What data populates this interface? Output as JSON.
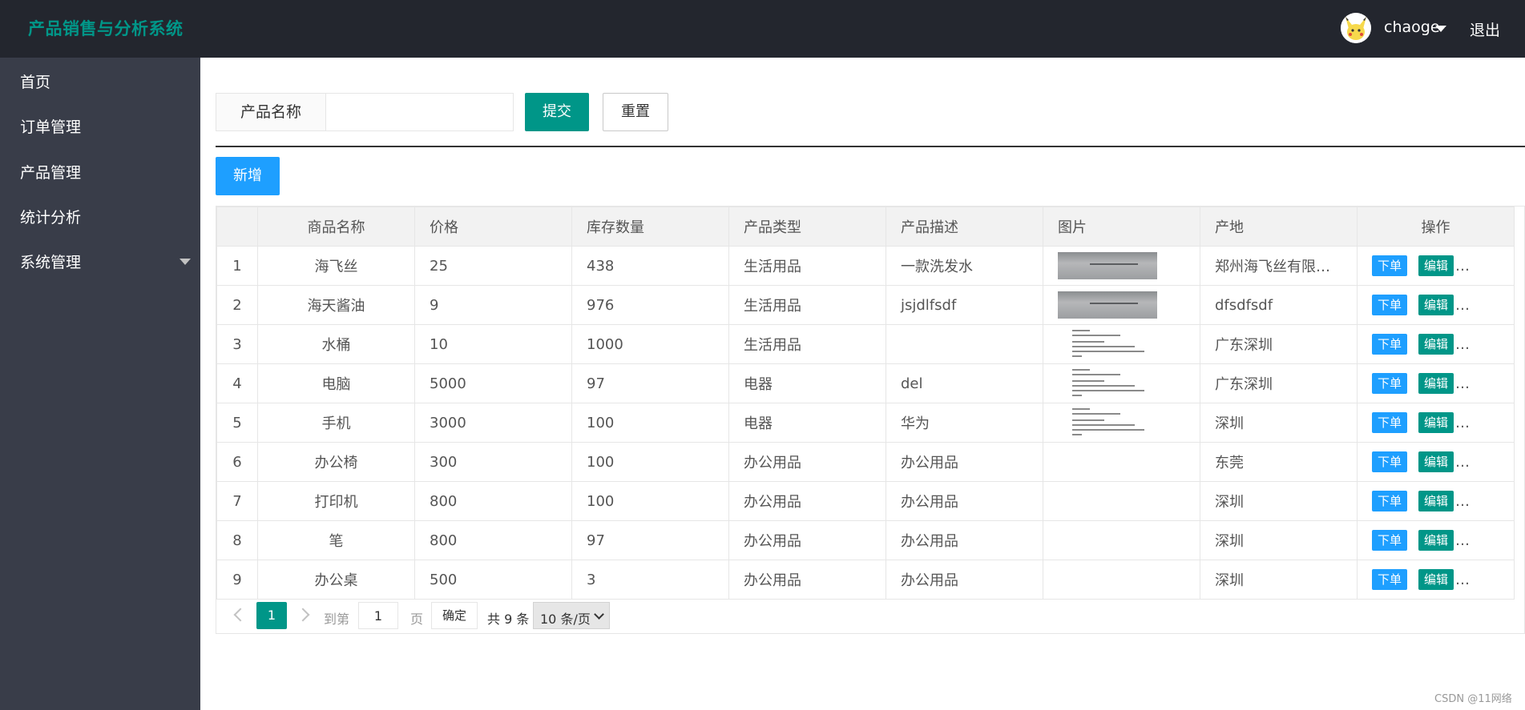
{
  "app": {
    "title": "产品销售与分析系统",
    "username": "chaoge",
    "logout_label": "退出"
  },
  "sidebar": {
    "items": [
      {
        "label": "首页"
      },
      {
        "label": "订单管理"
      },
      {
        "label": "产品管理"
      },
      {
        "label": "统计分析"
      },
      {
        "label": "系统管理",
        "has_submenu": true
      }
    ]
  },
  "search": {
    "label": "产品名称",
    "value": "",
    "submit_label": "提交",
    "reset_label": "重置"
  },
  "toolbar": {
    "add_label": "新增"
  },
  "table": {
    "columns": [
      "",
      "商品名称",
      "价格",
      "库存数量",
      "产品类型",
      "产品描述",
      "图片",
      "产地",
      "操作"
    ],
    "order_label": "下单",
    "edit_label": "编辑",
    "more_label": "…",
    "rows": [
      {
        "no": "1",
        "name": "海飞丝",
        "price": "25",
        "stock": "438",
        "type": "生活用品",
        "desc": "一款洗发水",
        "image": "photo",
        "origin": "郑州海飞丝有限责任公司"
      },
      {
        "no": "2",
        "name": "海天酱油",
        "price": "9",
        "stock": "976",
        "type": "生活用品",
        "desc": "jsjdlfsdf",
        "image": "photo",
        "origin": "dfsdfsdf"
      },
      {
        "no": "3",
        "name": "水桶",
        "price": "10",
        "stock": "1000",
        "type": "生活用品",
        "desc": "",
        "image": "document",
        "origin": "广东深圳"
      },
      {
        "no": "4",
        "name": "电脑",
        "price": "5000",
        "stock": "97",
        "type": "电器",
        "desc": "del",
        "image": "document",
        "origin": "广东深圳"
      },
      {
        "no": "5",
        "name": "手机",
        "price": "3000",
        "stock": "100",
        "type": "电器",
        "desc": "华为",
        "image": "document",
        "origin": "深圳"
      },
      {
        "no": "6",
        "name": "办公椅",
        "price": "300",
        "stock": "100",
        "type": "办公用品",
        "desc": "办公用品",
        "image": "",
        "origin": "东莞"
      },
      {
        "no": "7",
        "name": "打印机",
        "price": "800",
        "stock": "100",
        "type": "办公用品",
        "desc": "办公用品",
        "image": "",
        "origin": "深圳"
      },
      {
        "no": "8",
        "name": "笔",
        "price": "800",
        "stock": "97",
        "type": "办公用品",
        "desc": "办公用品",
        "image": "",
        "origin": "深圳"
      },
      {
        "no": "9",
        "name": "办公桌",
        "price": "500",
        "stock": "3",
        "type": "办公用品",
        "desc": "办公用品",
        "image": "",
        "origin": "深圳"
      }
    ]
  },
  "pager": {
    "current_page": "1",
    "goto_label": "到第",
    "goto_value": "1",
    "page_unit": "页",
    "confirm_label": "确定",
    "total_text": "共 9 条",
    "page_size": "10 条/页"
  },
  "watermark": "CSDN @11网络",
  "colors": {
    "header_bg": "#23262e",
    "sidebar_bg": "#393d49",
    "primary_green": "#009688",
    "primary_blue": "#1e9fff"
  }
}
